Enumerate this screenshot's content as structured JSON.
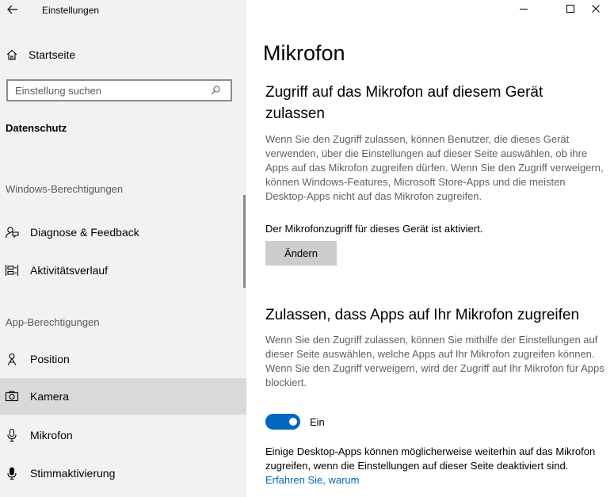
{
  "window": {
    "title": "Einstellungen"
  },
  "sidebar": {
    "home": "Startseite",
    "search_placeholder": "Einstellung suchen",
    "section": "Datenschutz",
    "groups": {
      "windows": "Windows-Berechtigungen",
      "app": "App-Berechtigungen"
    },
    "items": [
      {
        "label": "Diagnose & Feedback",
        "icon": "feedback-icon"
      },
      {
        "label": "Aktivitätsverlauf",
        "icon": "timeline-icon"
      },
      {
        "label": "Position",
        "icon": "location-icon"
      },
      {
        "label": "Kamera",
        "icon": "camera-icon"
      },
      {
        "label": "Mikrofon",
        "icon": "microphone-icon"
      },
      {
        "label": "Stimmaktivierung",
        "icon": "voice-icon"
      }
    ]
  },
  "main": {
    "title": "Mikrofon",
    "device_section": {
      "heading": "Zugriff auf das Mikrofon auf diesem Gerät zulassen",
      "description": "Wenn Sie den Zugriff zulassen, können Benutzer, die dieses Gerät verwenden, über die Einstellungen auf dieser Seite auswählen, ob ihre Apps auf das Mikrofon zugreifen dürfen. Wenn Sie den Zugriff verweigern, können Windows-Features, Microsoft Store-Apps und die meisten Desktop-Apps nicht auf das Mikrofon zugreifen.",
      "status": "Der Mikrofonzugriff für dieses Gerät ist aktiviert.",
      "button": "Ändern"
    },
    "apps_section": {
      "heading": "Zulassen, dass Apps auf Ihr Mikrofon zugreifen",
      "description": "Wenn Sie den Zugriff zulassen, können Sie mithilfe der Einstellungen auf dieser Seite auswählen, welche Apps auf Ihr Mikrofon zugreifen können. Wenn Sie den Zugriff verweigern, wird der Zugriff auf Ihr Mikrofon für Apps blockiert.",
      "toggle_label": "Ein",
      "note": "Einige Desktop-Apps können möglicherweise weiterhin auf das Mikrofon zugreifen, wenn die Einstellungen auf dieser Seite deaktiviert sind.",
      "link": "Erfahren Sie, warum"
    }
  },
  "colors": {
    "accent": "#0067c0",
    "sidebar_bg": "#f2f2f2",
    "selected_bg": "#d9d9d9"
  }
}
